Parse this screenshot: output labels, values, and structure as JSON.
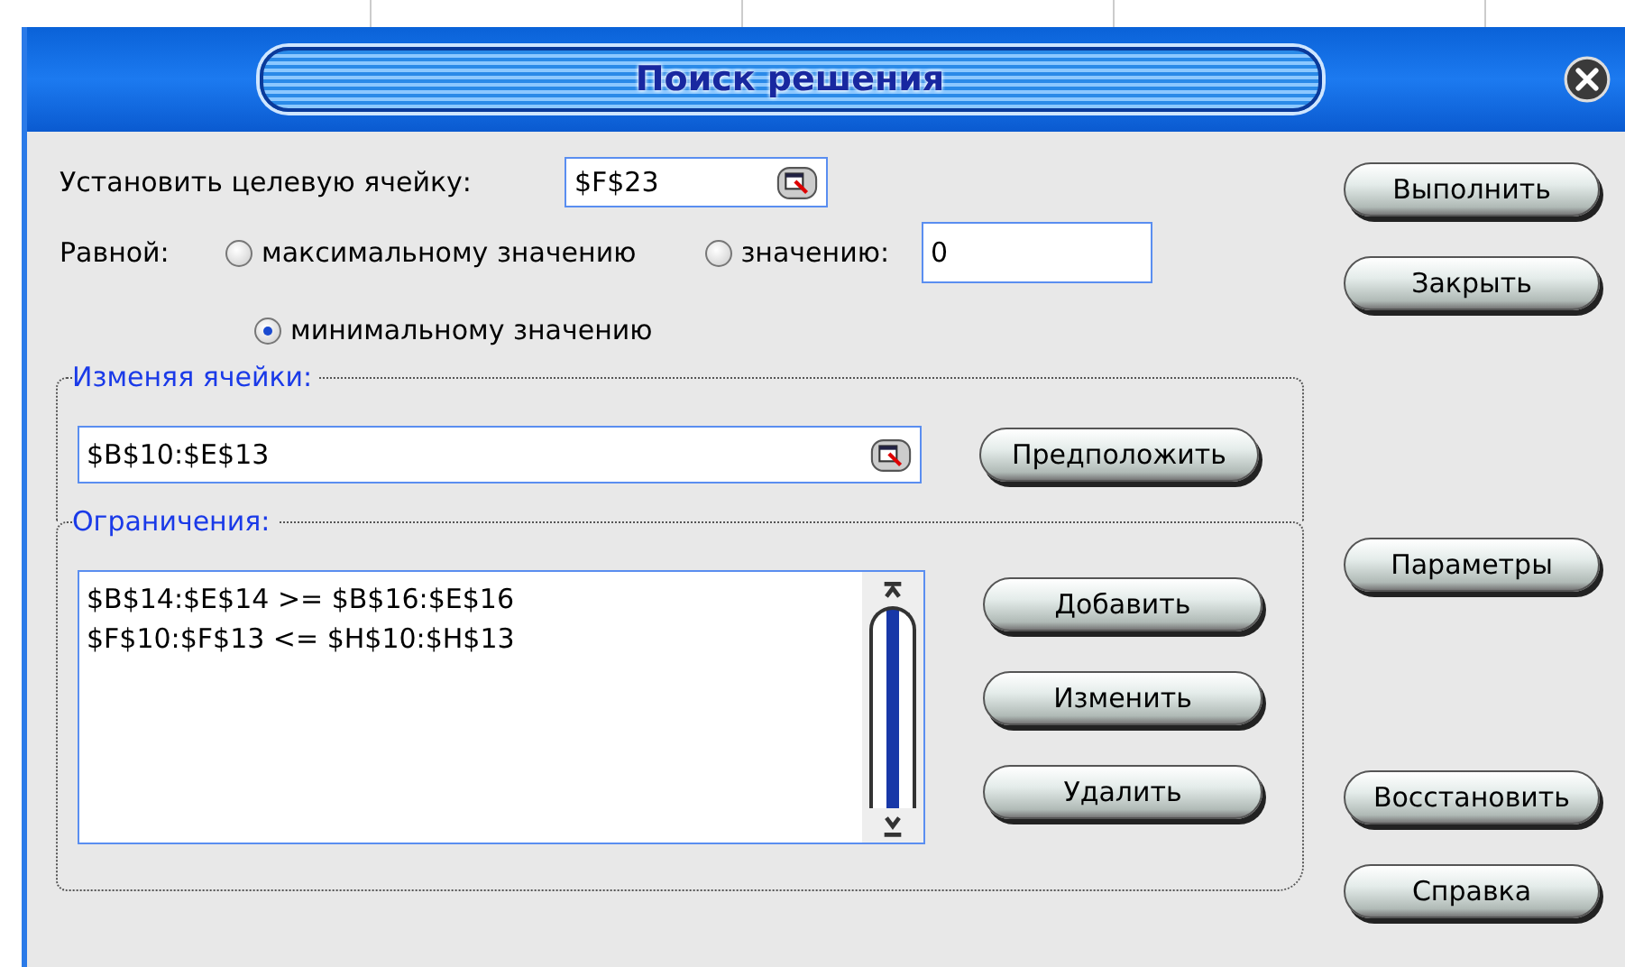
{
  "window": {
    "title": "Поиск решения"
  },
  "target": {
    "label": "Установить целевую ячейку:",
    "value": "$F$23"
  },
  "equal": {
    "label": "Равной:",
    "value": "0",
    "options": [
      {
        "label": "максимальному значению",
        "selected": false
      },
      {
        "label": "значению:",
        "selected": false
      },
      {
        "label": "минимальному значению",
        "selected": true
      }
    ]
  },
  "changing": {
    "title": "Изменяя ячейки:",
    "value": "$B$10:$E$13",
    "button": "Предположить"
  },
  "constraints": {
    "title": "Ограничения:",
    "items": [
      "$B$14:$E$14 >= $B$16:$E$16",
      "$F$10:$F$13 <= $H$10:$H$13"
    ],
    "buttons": [
      "Добавить",
      "Изменить",
      "Удалить"
    ]
  },
  "side_buttons": [
    "Выполнить",
    "Закрыть",
    "Параметры",
    "Восстановить",
    "Справка"
  ]
}
